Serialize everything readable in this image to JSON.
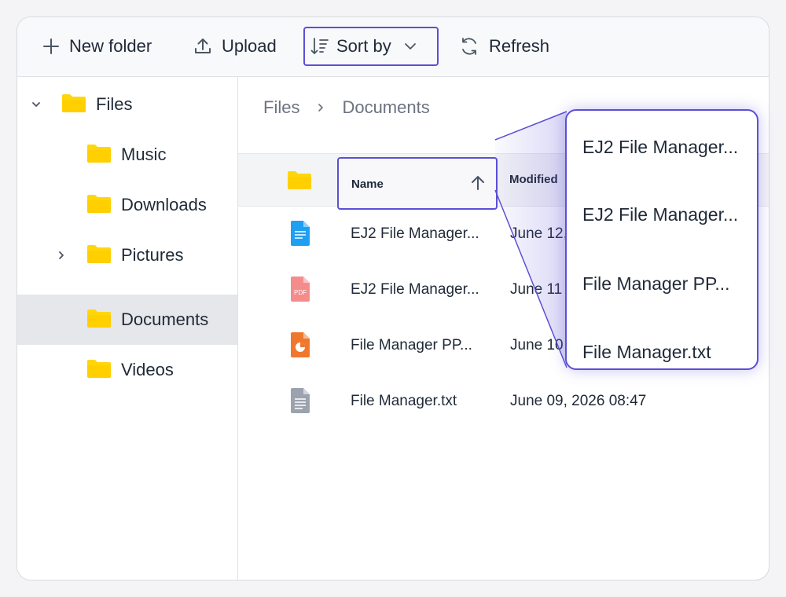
{
  "toolbar": {
    "new_folder": "New folder",
    "upload": "Upload",
    "sort_by": "Sort by",
    "refresh": "Refresh"
  },
  "sidebar": {
    "root": "Files",
    "items": [
      {
        "label": "Music"
      },
      {
        "label": "Downloads"
      },
      {
        "label": "Pictures"
      },
      {
        "label": "Documents"
      },
      {
        "label": "Videos"
      }
    ]
  },
  "breadcrumb": {
    "root": "Files",
    "current": "Documents"
  },
  "grid": {
    "headers": {
      "name": "Name",
      "modified": "Modified"
    },
    "rows": [
      {
        "name": "EJ2 File Manager...",
        "modified": "June 12,",
        "type": "doc-icon"
      },
      {
        "name": "EJ2 File Manager...",
        "modified": "June 11",
        "type": "pdf-icon"
      },
      {
        "name": "File Manager PP...",
        "modified": "June 10",
        "type": "ppt-icon"
      },
      {
        "name": "File Manager.txt",
        "modified": "June 09, 2026 08:47",
        "type": "txt-icon"
      }
    ]
  },
  "popup": {
    "items": [
      "EJ2 File Manager...",
      "EJ2 File Manager...",
      "File Manager PP...",
      "File Manager.txt"
    ]
  },
  "colors": {
    "accent": "#5b4fd6",
    "folder": "#ffd60a",
    "doc": "#1e9ff2",
    "pdf": "#f58c8c",
    "ppt": "#f0772e",
    "txt": "#9ca3af"
  }
}
